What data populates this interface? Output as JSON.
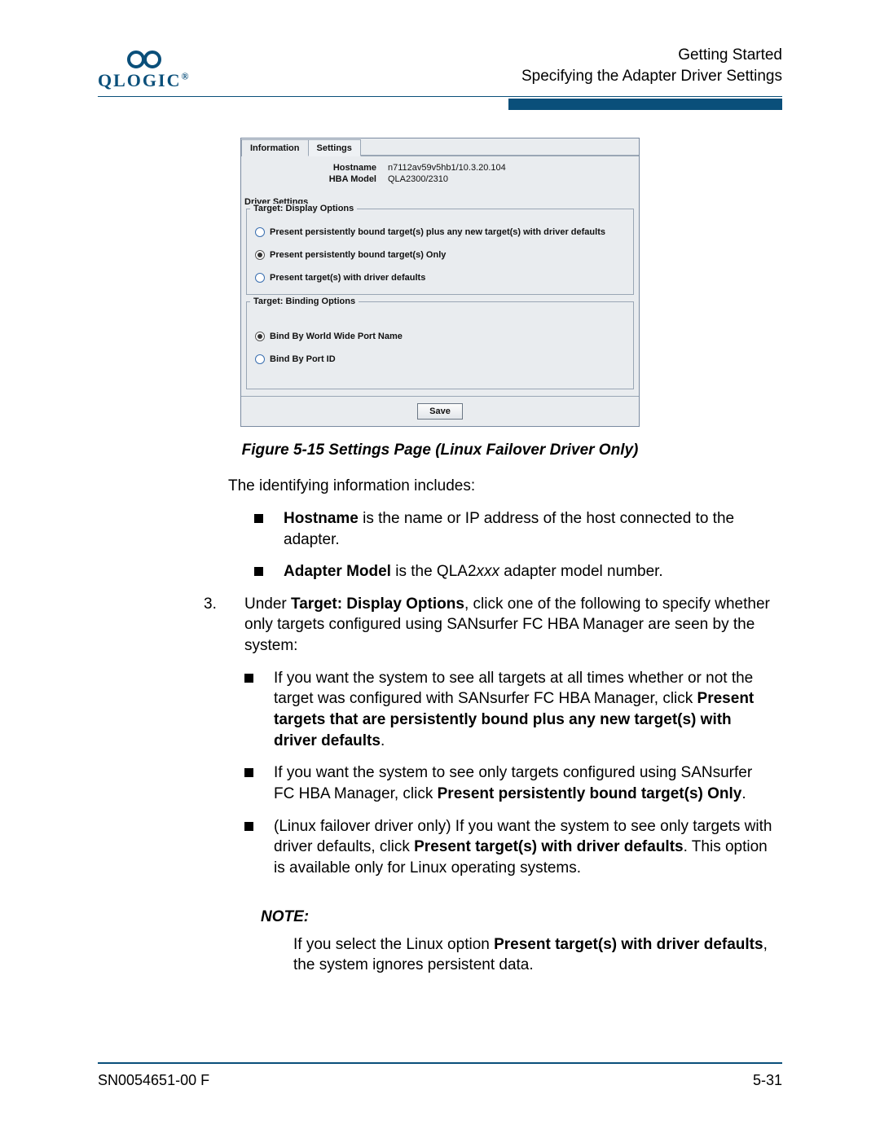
{
  "header": {
    "logo_text": "QLOGIC",
    "line1": "Getting Started",
    "line2": "Specifying the Adapter Driver Settings"
  },
  "panel": {
    "tabs": {
      "info": "Information",
      "settings": "Settings"
    },
    "hostname_label": "Hostname",
    "hostname_value": "n7112av59v5hb1/10.3.20.104",
    "model_label": "HBA Model",
    "model_value": "QLA2300/2310",
    "driver_settings": "Driver Settings",
    "display_legend": "Target: Display Options",
    "opt1": "Present persistently bound target(s) plus any new target(s) with driver defaults",
    "opt2": "Present persistently bound target(s) Only",
    "opt3": "Present target(s) with driver defaults",
    "binding_legend": "Target: Binding Options",
    "bind1": "Bind By World Wide Port Name",
    "bind2": "Bind By Port ID",
    "save": "Save"
  },
  "caption": "Figure 5-15  Settings Page (Linux Failover Driver Only)",
  "intro": "The identifying information includes:",
  "bullets1": {
    "b1_bold": "Hostname",
    "b1_rest": " is the name or IP address of the host connected to the adapter.",
    "b2_bold": "Adapter Model",
    "b2_rest_a": " is the QLA2",
    "b2_rest_i": "xxx",
    "b2_rest_b": " adapter model number."
  },
  "step3": {
    "num": "3.",
    "text_a": "Under ",
    "text_bold": "Target: Display Options",
    "text_b": ", click one of the following to specify whether only targets configured using SANsurfer FC HBA Manager are seen by the system:",
    "s1_a": "If you want the system to see all targets at all times whether or not the target was configured with SANsurfer FC HBA Manager, click ",
    "s1_bold": "Present targets that are persistently bound plus any new target(s) with driver defaults",
    "s1_b": ".",
    "s2_a": "If you want the system to see only targets configured using SANsurfer FC HBA Manager, click ",
    "s2_bold": "Present persistently bound target(s) Only",
    "s2_b": ".",
    "s3_a": "(Linux failover driver only) If you want the system to see only targets with driver defaults, click ",
    "s3_bold": "Present target(s) with driver defaults",
    "s3_b": ". This option is available only for Linux operating systems."
  },
  "note": {
    "head": "NOTE:",
    "body_a": "If you select the Linux option ",
    "body_bold": "Present target(s) with driver defaults",
    "body_b": ", the system ignores persistent data."
  },
  "footer": {
    "left": "SN0054651-00  F",
    "right": "5-31"
  }
}
